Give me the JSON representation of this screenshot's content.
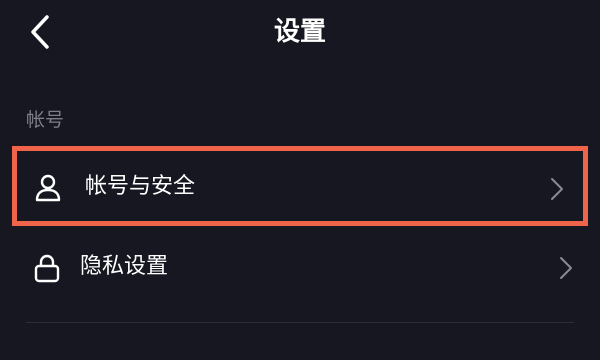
{
  "header": {
    "back_icon": "chevron-left-icon",
    "title": "设置"
  },
  "sections": [
    {
      "label": "帐号",
      "items": [
        {
          "label": "帐号与安全",
          "icon": "user-icon",
          "highlighted": true
        },
        {
          "label": "隐私设置",
          "icon": "lock-icon",
          "highlighted": false
        }
      ]
    }
  ],
  "colors": {
    "background": "#161720",
    "text": "#ffffff",
    "section_label": "#7d7e86",
    "highlight_border": "#f0654a",
    "chevron": "#8a8b92"
  }
}
